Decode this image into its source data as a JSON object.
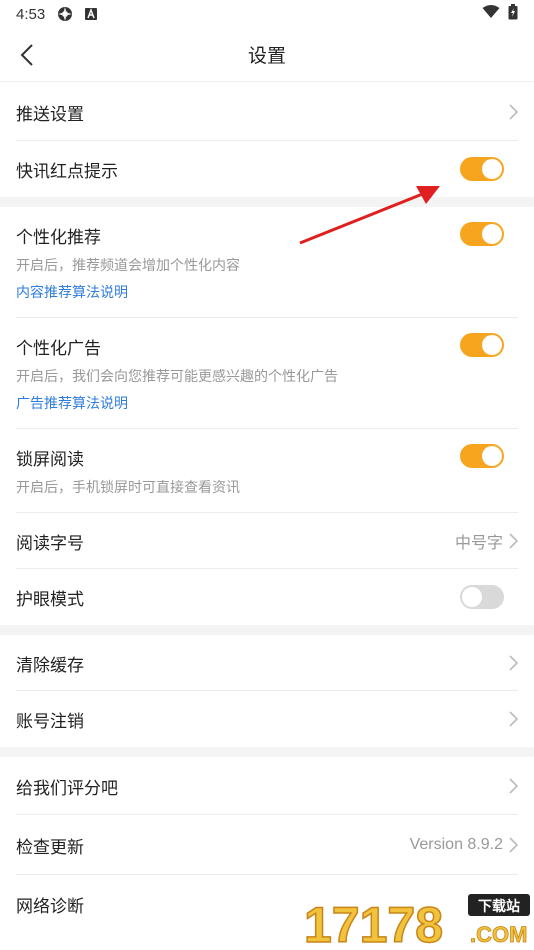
{
  "status_bar": {
    "time": "4:53",
    "icons": [
      "settings-gear-icon",
      "a-badge-icon",
      "wifi-icon",
      "battery-icon"
    ]
  },
  "header": {
    "title": "设置",
    "back_icon": "chevron-left-icon"
  },
  "rows": {
    "push_settings": {
      "label": "推送设置"
    },
    "news_red_dot": {
      "label": "快讯红点提示",
      "toggle": true
    },
    "personalized_recommend": {
      "label": "个性化推荐",
      "desc": "开启后，推荐频道会增加个性化内容",
      "link": "内容推荐算法说明",
      "toggle": true
    },
    "personalized_ads": {
      "label": "个性化广告",
      "desc": "开启后，我们会向您推荐可能更感兴趣的个性化广告",
      "link": "广告推荐算法说明",
      "toggle": true
    },
    "lockscreen_read": {
      "label": "锁屏阅读",
      "desc": "开启后，手机锁屏时可直接查看资讯",
      "toggle": true
    },
    "font_size": {
      "label": "阅读字号",
      "value": "中号字"
    },
    "eye_care": {
      "label": "护眼模式",
      "toggle": false
    },
    "clear_cache": {
      "label": "清除缓存"
    },
    "delete_account": {
      "label": "账号注销"
    },
    "rate_us": {
      "label": "给我们评分吧"
    },
    "check_update": {
      "label": "检查更新",
      "value": "Version 8.9.2"
    },
    "network_diagnose": {
      "label": "网络诊断"
    }
  },
  "watermark": {
    "digits": "17178",
    "badge": "下载站",
    "suffix": ".COM"
  },
  "colors": {
    "toggle_on": "#f7a51e",
    "toggle_off": "#d9d9d9",
    "link": "#2f7ddc",
    "arrow": "#e02020"
  }
}
